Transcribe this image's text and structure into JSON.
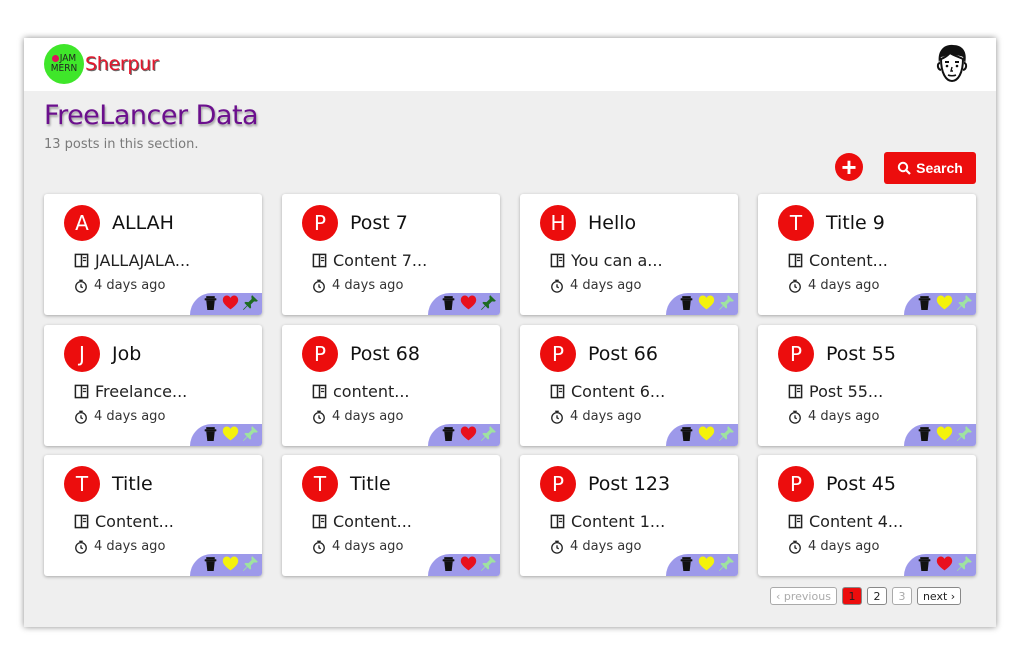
{
  "brand": {
    "badge_line1": "JAM",
    "badge_line2": "MERN",
    "name": "Sherpur"
  },
  "header": {
    "title": "FreeLancer Data",
    "subtitle": "13 posts in this section."
  },
  "toolbar": {
    "add_label": "+",
    "search_label": "Search"
  },
  "colors": {
    "accent": "#ec0d0d",
    "title": "#6b0f8d",
    "action_bar": "#9d99ea",
    "heart_red": "#e8101e",
    "heart_yellow": "#f4f20c",
    "pin_dark": "#1d6b22",
    "pin_light": "#9fe3a0"
  },
  "posts": [
    {
      "letter": "A",
      "title": "ALLAH",
      "content": "JALLAJALA...",
      "time": "4 days ago",
      "liked": true,
      "pinned": true
    },
    {
      "letter": "P",
      "title": "Post 7",
      "content": "Content 7...",
      "time": "4 days ago",
      "liked": true,
      "pinned": true
    },
    {
      "letter": "H",
      "title": "Hello",
      "content": "You can a...",
      "time": "4 days ago",
      "liked": false,
      "pinned": false
    },
    {
      "letter": "T",
      "title": "Title 9",
      "content": "Content...",
      "time": "4 days ago",
      "liked": false,
      "pinned": false
    },
    {
      "letter": "J",
      "title": "Job",
      "content": "Freelance...",
      "time": "4 days ago",
      "liked": false,
      "pinned": false
    },
    {
      "letter": "P",
      "title": "Post 68",
      "content": "content...",
      "time": "4 days ago",
      "liked": true,
      "pinned": false
    },
    {
      "letter": "P",
      "title": "Post 66",
      "content": "Content 6...",
      "time": "4 days ago",
      "liked": false,
      "pinned": false
    },
    {
      "letter": "P",
      "title": "Post 55",
      "content": "Post 55...",
      "time": "4 days ago",
      "liked": false,
      "pinned": false
    },
    {
      "letter": "T",
      "title": "Title",
      "content": "Content...",
      "time": "4 days ago",
      "liked": false,
      "pinned": false
    },
    {
      "letter": "T",
      "title": "Title",
      "content": "Content...",
      "time": "4 days ago",
      "liked": true,
      "pinned": false
    },
    {
      "letter": "P",
      "title": "Post 123",
      "content": "Content 1...",
      "time": "4 days ago",
      "liked": false,
      "pinned": false
    },
    {
      "letter": "P",
      "title": "Post 45",
      "content": "Content 4...",
      "time": "4 days ago",
      "liked": true,
      "pinned": false
    }
  ],
  "pagination": {
    "previous_label": "‹ previous",
    "pages": [
      "1",
      "2",
      "3"
    ],
    "current_page": 1,
    "next_label": "next ›"
  }
}
